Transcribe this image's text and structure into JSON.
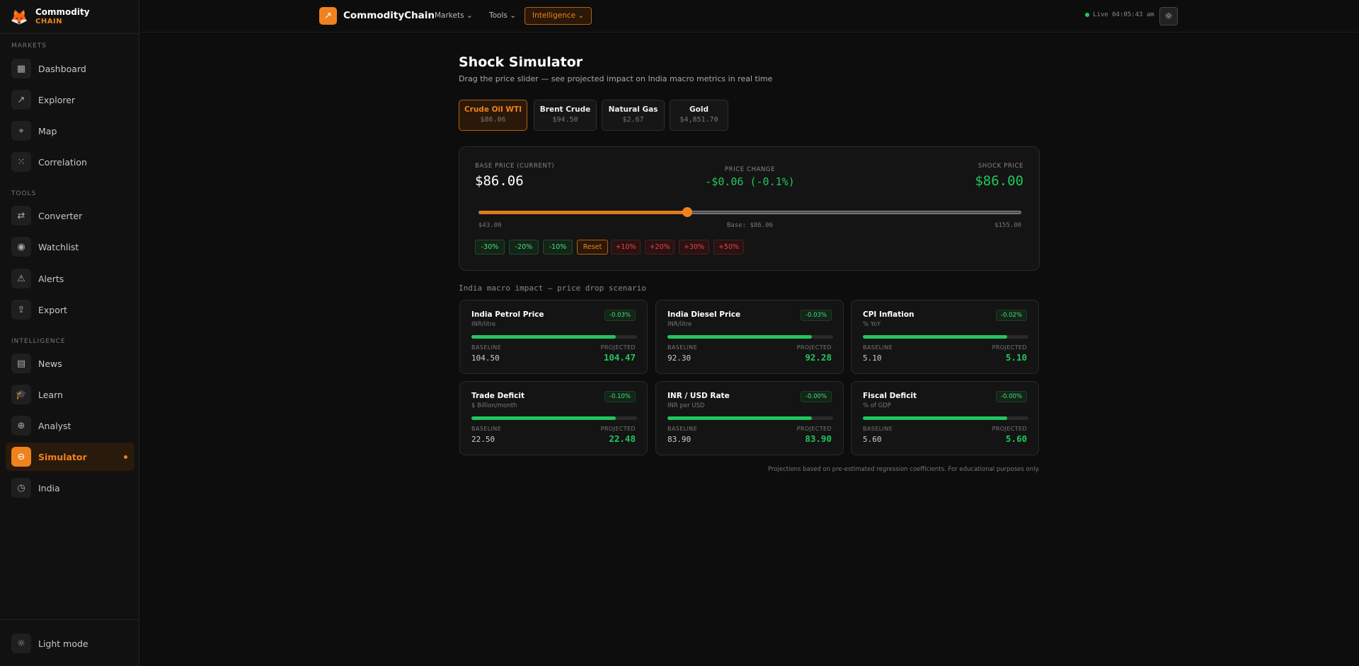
{
  "brand": {
    "name": "Commodity",
    "sub": "CHAIN"
  },
  "sidebar": {
    "sections": {
      "markets": "MARKETS",
      "tools": "TOOLS",
      "intelligence": "INTELLIGENCE"
    },
    "items": [
      {
        "label": "Dashboard",
        "icon": "grid-icon"
      },
      {
        "label": "Explorer",
        "icon": "trend-icon"
      },
      {
        "label": "Map",
        "icon": "pin-icon"
      },
      {
        "label": "Correlation",
        "icon": "dots-grid-icon"
      },
      {
        "label": "Converter",
        "icon": "swap-icon"
      },
      {
        "label": "Watchlist",
        "icon": "eye-icon"
      },
      {
        "label": "Alerts",
        "icon": "warning-icon"
      },
      {
        "label": "Export",
        "icon": "upload-icon"
      },
      {
        "label": "News",
        "icon": "newspaper-icon"
      },
      {
        "label": "Learn",
        "icon": "graduation-cap-icon"
      },
      {
        "label": "Analyst",
        "icon": "target-icon"
      },
      {
        "label": "Simulator",
        "icon": "toggle-icon",
        "active": true
      },
      {
        "label": "India",
        "icon": "clock-icon"
      }
    ],
    "light_mode": "Light mode"
  },
  "topbar": {
    "title": "CommodityChain",
    "menus": {
      "markets": "Markets",
      "tools": "Tools",
      "intelligence": "Intelligence"
    },
    "live": "Live 04:05:43 am"
  },
  "page": {
    "title": "Shock Simulator",
    "subtitle": "Drag the price slider — see projected impact on India macro metrics in real time"
  },
  "tabs": [
    {
      "name": "Crude Oil WTI",
      "price": "$86.06",
      "active": true
    },
    {
      "name": "Brent Crude",
      "price": "$94.50"
    },
    {
      "name": "Natural Gas",
      "price": "$2.67"
    },
    {
      "name": "Gold",
      "price": "$4,851.70"
    }
  ],
  "panel": {
    "base_label": "BASE PRICE (CURRENT)",
    "base_value": "$86.06",
    "change_label": "PRICE CHANGE",
    "change_value": "-$0.06 (-0.1%)",
    "shock_label": "SHOCK PRICE",
    "shock_value": "$86.00",
    "min_label": "$43.00",
    "base_mid_label": "Base: $86.06",
    "max_label": "$155.00",
    "slider": {
      "min": 43,
      "max": 155,
      "value": 86
    },
    "buttons": [
      "-30%",
      "-20%",
      "-10%",
      "Reset",
      "+10%",
      "+20%",
      "+30%",
      "+50%"
    ]
  },
  "impact_title": "India macro impact — price drop scenario",
  "labels": {
    "baseline": "BASELINE",
    "projected": "PROJECTED"
  },
  "cards": [
    {
      "title": "India Petrol Price",
      "unit": "INR/litre",
      "delta": "-0.03%",
      "baseline": "104.50",
      "projected": "104.47",
      "level": 0.87
    },
    {
      "title": "India Diesel Price",
      "unit": "INR/litre",
      "delta": "-0.03%",
      "baseline": "92.30",
      "projected": "92.28",
      "level": 0.87
    },
    {
      "title": "CPI Inflation",
      "unit": "% YoY",
      "delta": "-0.02%",
      "baseline": "5.10",
      "projected": "5.10",
      "level": 0.87
    },
    {
      "title": "Trade Deficit",
      "unit": "$ Billion/month",
      "delta": "-0.10%",
      "baseline": "22.50",
      "projected": "22.48",
      "level": 0.87
    },
    {
      "title": "INR / USD Rate",
      "unit": "INR per USD",
      "delta": "-0.00%",
      "baseline": "83.90",
      "projected": "83.90",
      "level": 0.87
    },
    {
      "title": "Fiscal Deficit",
      "unit": "% of GDP",
      "delta": "-0.00%",
      "baseline": "5.60",
      "projected": "5.60",
      "level": 0.87
    }
  ],
  "footnote": "Projections based on pre-estimated regression coefficients. For educational purposes only.",
  "colors": {
    "accent": "#f0821e",
    "positive": "#22c55e",
    "negative": "#ef4444"
  }
}
